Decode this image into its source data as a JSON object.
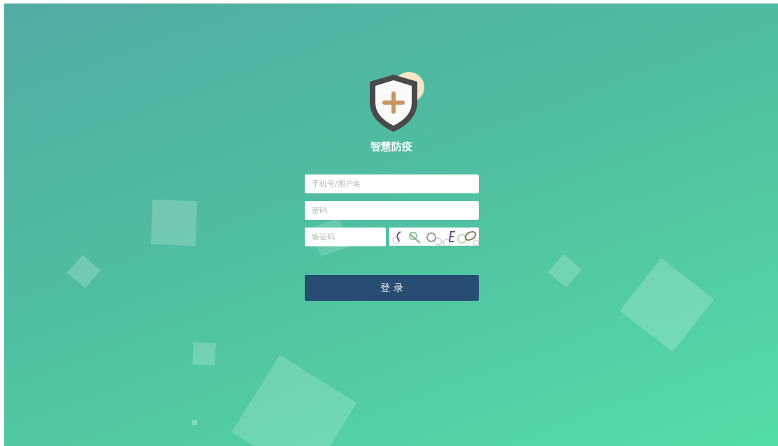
{
  "app_title": "智慧防疫",
  "fields": [
    {
      "placeholder": "手机号/用户名"
    },
    {
      "placeholder": "密码"
    }
  ],
  "captcha": {
    "placeholder": "验证码"
  },
  "login_button": "登 录"
}
